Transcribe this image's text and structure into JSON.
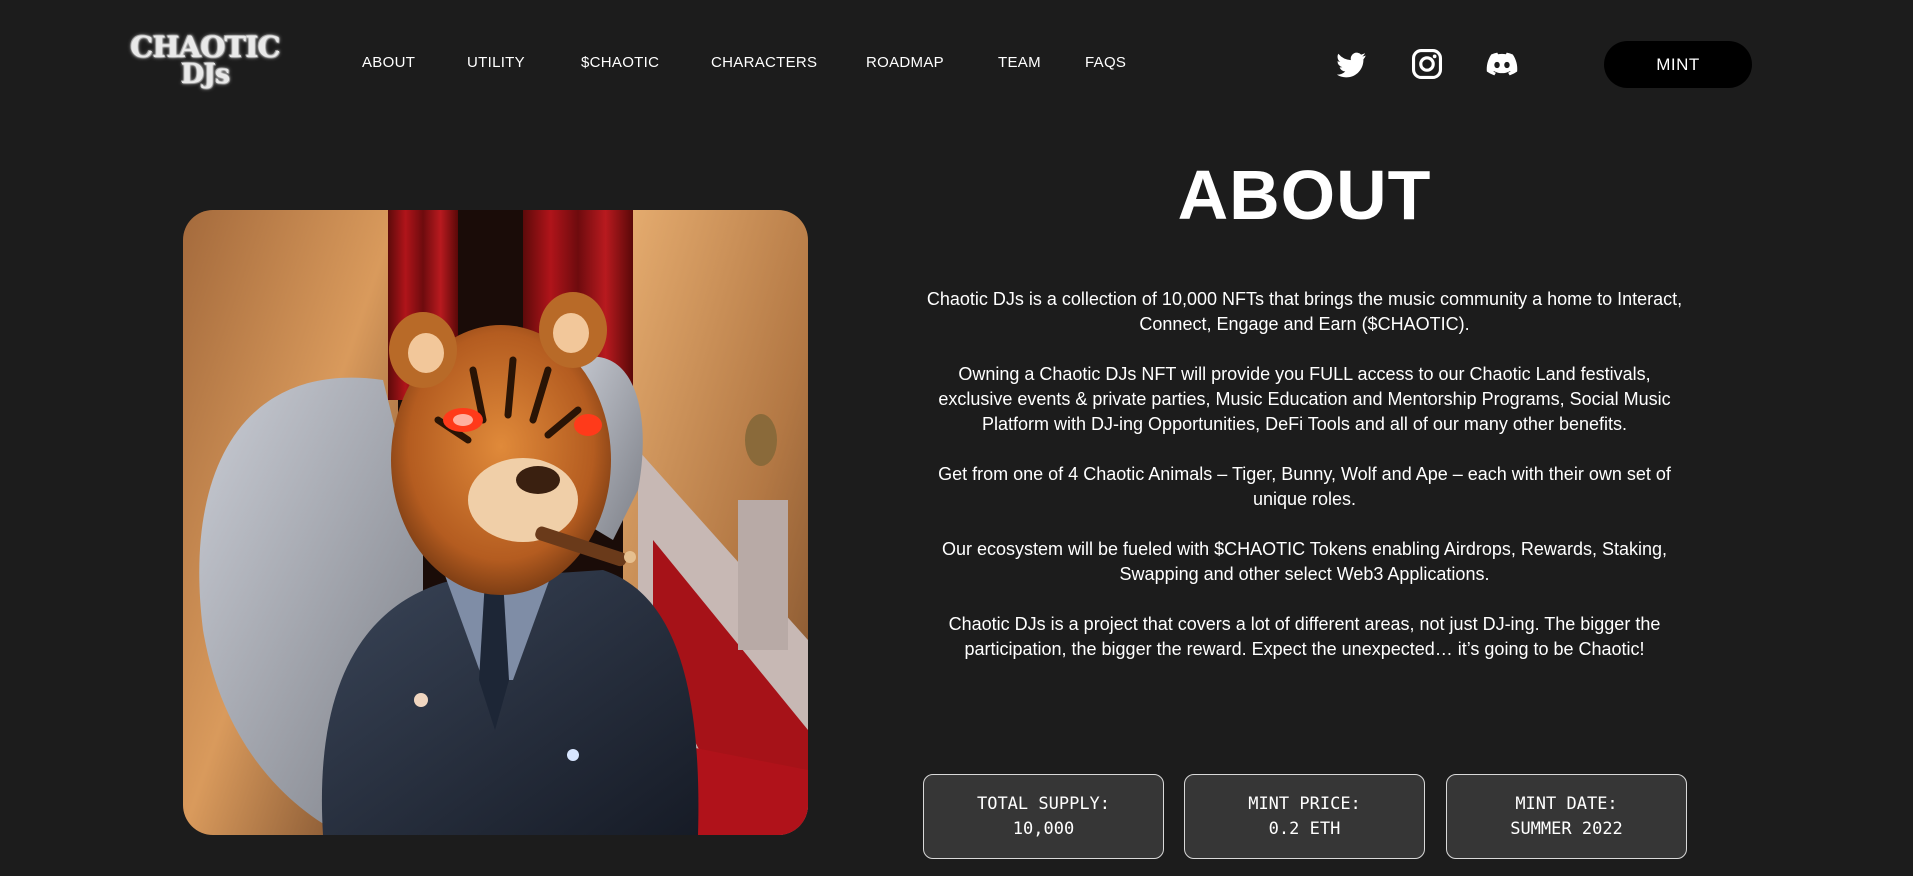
{
  "logo": {
    "line1": "CHAOTIC",
    "line2": "DJs"
  },
  "nav": {
    "items": [
      {
        "label": "ABOUT"
      },
      {
        "label": "UTILITY"
      },
      {
        "label": "$CHAOTIC"
      },
      {
        "label": "CHARACTERS"
      },
      {
        "label": "ROADMAP"
      },
      {
        "label": "TEAM"
      },
      {
        "label": "FAQS"
      }
    ],
    "social": [
      "twitter-icon",
      "instagram-icon",
      "discord-icon"
    ],
    "mint_label": "MINT"
  },
  "about": {
    "title": "ABOUT",
    "paragraphs": [
      "Chaotic DJs is a collection of 10,000 NFTs that brings the music community a home to Interact, Connect, Engage and Earn ($CHAOTIC).",
      "Owning a Chaotic DJs NFT will provide you FULL access to our Chaotic Land festivals, exclusive events & private parties, Music Education and Mentorship Programs, Social Music Platform with DJ-ing Opportunities, DeFi Tools and all of our many other benefits.",
      "Get from one of 4 Chaotic Animals – Tiger, Bunny, Wolf and Ape – each with their own set of unique roles.",
      "Our ecosystem will be fueled with $CHAOTIC Tokens enabling Airdrops, Rewards, Staking, Swapping and other select Web3 Applications.",
      "Chaotic DJs is a project that covers a lot of different areas, not just DJ-ing. The bigger the participation, the bigger the reward. Expect the unexpected… it’s going to be Chaotic!"
    ]
  },
  "stats": [
    {
      "label": "TOTAL SUPPLY:",
      "value": "10,000"
    },
    {
      "label": "MINT PRICE:",
      "value": "0.2 ETH"
    },
    {
      "label": "MINT DATE:",
      "value": "SUMMER 2022"
    }
  ],
  "colors": {
    "background": "#1c1c1c",
    "card_background": "#363636",
    "mint_button": "#000000",
    "text": "#ffffff"
  }
}
